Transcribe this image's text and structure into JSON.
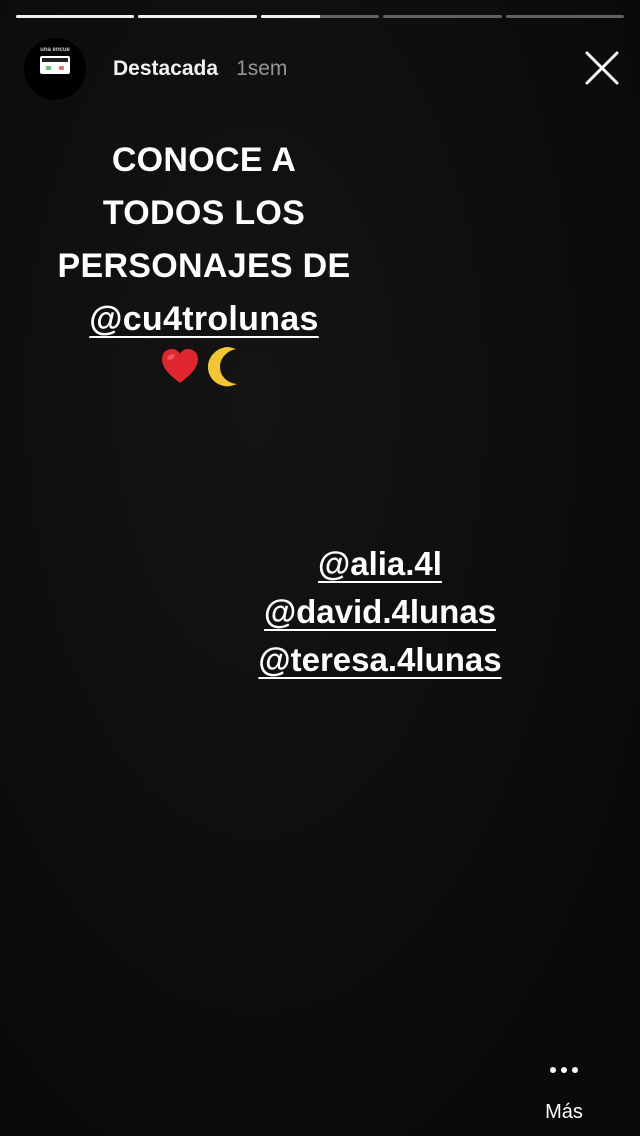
{
  "progress": {
    "segments": [
      1,
      1,
      0.5,
      0,
      0
    ]
  },
  "header": {
    "avatar_text": "una encue",
    "username": "Destacada",
    "time": "1sem",
    "close_icon": "close-icon"
  },
  "story": {
    "headline_lines": [
      "CONOCE A",
      "TODOS LOS",
      "PERSONAJES DE"
    ],
    "headline_mention": "@cu4trolunas",
    "emojis": [
      "heart-icon",
      "crescent-moon-icon"
    ],
    "mentions": [
      "@alia.4l",
      "@david.4lunas",
      "@teresa.4lunas"
    ]
  },
  "footer": {
    "more_label": "Más",
    "more_icon": "more-dots-icon"
  },
  "colors": {
    "background": "#0b0b0b",
    "text": "#ffffff",
    "heart": "#e0262e",
    "moon": "#f2c531"
  }
}
